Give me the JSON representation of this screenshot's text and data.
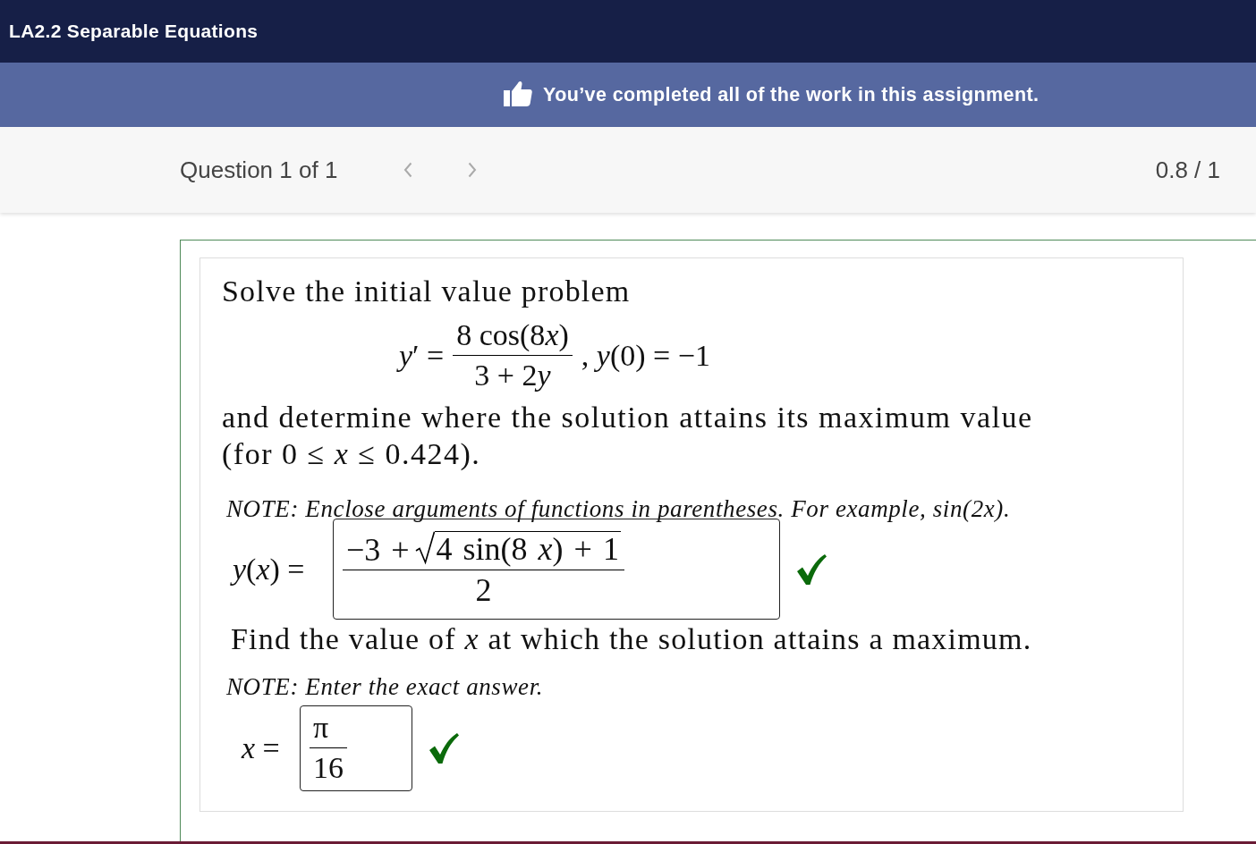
{
  "header": {
    "title": "LA2.2 Separable Equations"
  },
  "banner": {
    "message": "You’ve completed all of the work in this assignment."
  },
  "question_bar": {
    "position": "Question 1 of 1",
    "nav": [
      {
        "kind": "previous",
        "disabled": true
      },
      {
        "kind": "next",
        "disabled": true
      }
    ],
    "score": "0.8 / 1"
  },
  "question": {
    "prompt": "Solve the initial value problem",
    "equation": {
      "lhs": "*y*′ =",
      "numerator": [
        {
          "text": "8 cos(8",
          "italic": false
        },
        {
          "text": "x",
          "italic": true
        },
        {
          "text": ")",
          "italic": false
        }
      ],
      "denominator": [
        {
          "text": "3 + 2",
          "italic": false
        },
        {
          "text": "y",
          "italic": true
        }
      ],
      "condition": ", *y*(0) = −1"
    },
    "task": {
      "text": "and determine where the solution attains its maximum value",
      "range": "(for 0 ≤ *x* ≤ 0.424)."
    },
    "parts": [
      {
        "kind": "note",
        "text": "NOTE: Enclose arguments of functions in parentheses. For example, sin(2x)."
      },
      {
        "kind": "answer",
        "label": "*y*(*x*) =",
        "numerator": "−3 +",
        "radicand": "4 sin(8 *x*) + 1",
        "denominator": "2",
        "correct": true
      },
      {
        "kind": "question",
        "text": "Find the value of *x* at which the solution attains a maximum."
      },
      {
        "kind": "note",
        "text": "NOTE: Enter the exact answer."
      },
      {
        "kind": "answer",
        "label": "*x* =",
        "numerator": "π",
        "denominator": "16",
        "correct": true
      }
    ]
  }
}
